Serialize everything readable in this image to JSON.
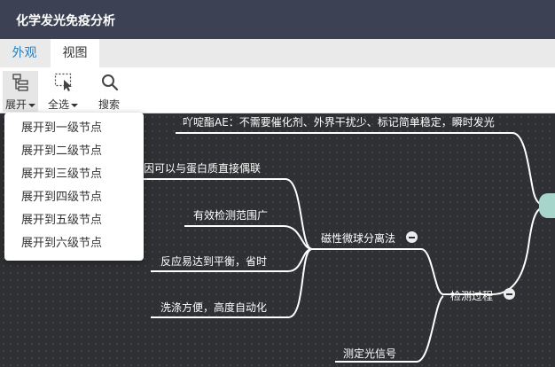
{
  "app": {
    "title": "化学发光免疫分析"
  },
  "tabs": [
    {
      "label": "外观"
    },
    {
      "label": "视图"
    }
  ],
  "toolbar": {
    "expand_label": "展开",
    "select_all_label": "全选",
    "search_label": "搜索"
  },
  "expand_menu": {
    "items": [
      {
        "label": "展开到一级节点"
      },
      {
        "label": "展开到二级节点"
      },
      {
        "label": "展开到三级节点"
      },
      {
        "label": "展开到四级节点"
      },
      {
        "label": "展开到五级节点"
      },
      {
        "label": "展开到六级节点"
      }
    ]
  },
  "mindmap": {
    "nodes": {
      "ae_label": "吖啶酯AE：不需要催化剂、外界干扰少、标记简单稳定，瞬时发光",
      "gene_coupling": "基因可以与蛋白质直接偶联",
      "magnetic_separation": "磁性微球分离法",
      "wide_range": "有效检测范围广",
      "fast_equilibrium": "反应易达到平衡，省时",
      "automation": "洗涤方便，高度自动化",
      "detection_process": "检测过程",
      "measure_signal": "测定光信号"
    }
  }
}
